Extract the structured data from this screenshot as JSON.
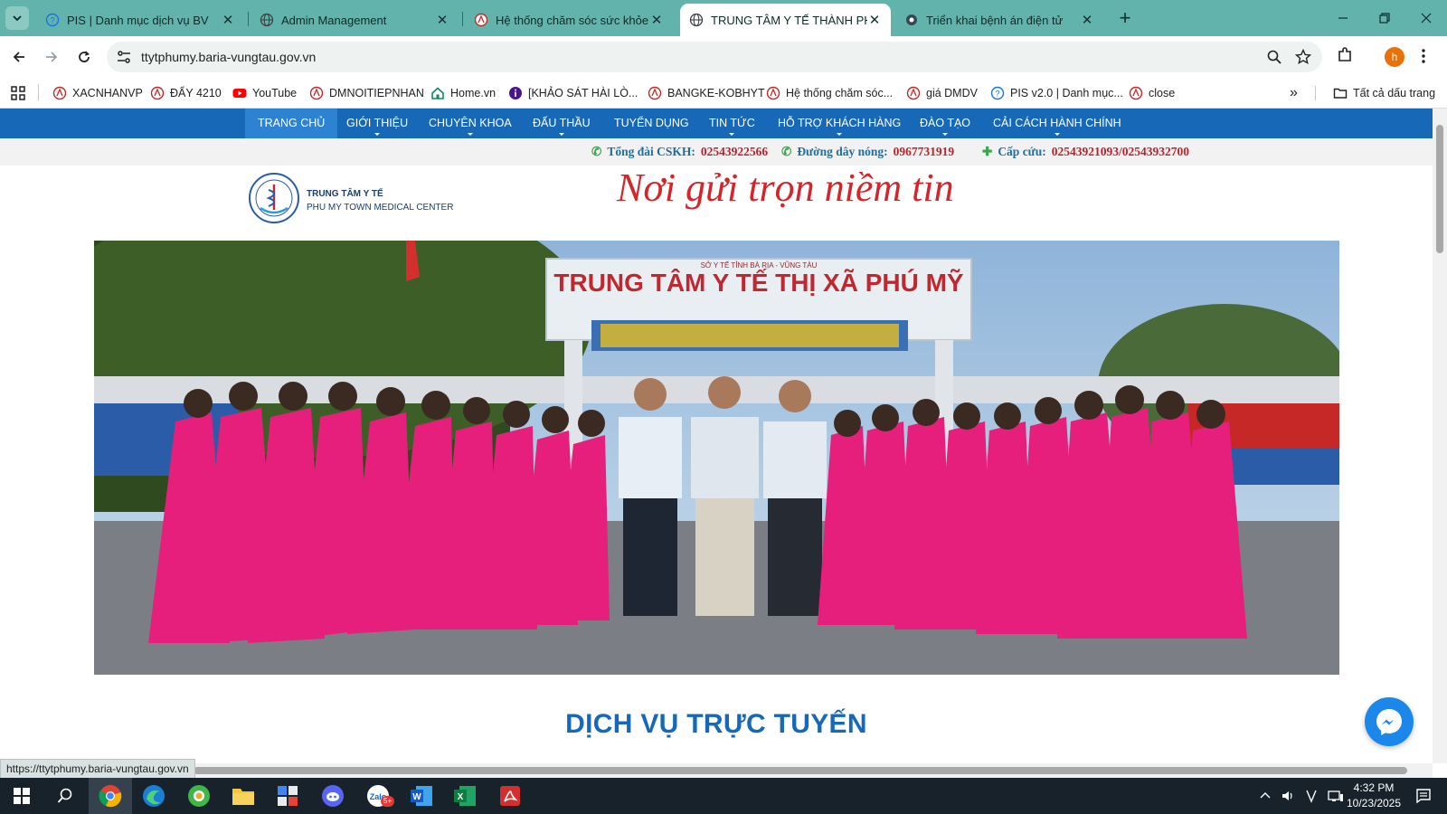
{
  "browser": {
    "tabs": [
      {
        "label": "PIS | Danh mục dịch vụ BV",
        "icon": "globe-question-icon",
        "active": false
      },
      {
        "label": "Admin Management",
        "icon": "globe-icon",
        "active": false
      },
      {
        "label": "Hệ thống chăm sóc sức khỏe",
        "icon": "health-logo-icon",
        "active": false
      },
      {
        "label": "TRUNG TÂM Y TẾ THÀNH PHỐ",
        "icon": "globe-icon",
        "active": true
      },
      {
        "label": "Triển khai bệnh án điện tử",
        "icon": "shield-gear-icon",
        "active": false
      }
    ],
    "url": "ttytphumy.baria-vungtau.gov.vn",
    "profile_initial": "h",
    "bookmarks": [
      {
        "label": "XACNHANVP",
        "icon": "health-logo-icon"
      },
      {
        "label": "ĐẨY 4210",
        "icon": "health-logo-icon"
      },
      {
        "label": "YouTube",
        "icon": "youtube-icon"
      },
      {
        "label": "DMNOITIEPNHAN",
        "icon": "health-logo-icon"
      },
      {
        "label": "Home.vn",
        "icon": "home-icon"
      },
      {
        "label": "[KHẢO SÁT HÀI LÒ...",
        "icon": "info-icon"
      },
      {
        "label": "BANGKE-KOBHYT",
        "icon": "health-logo-icon"
      },
      {
        "label": "Hệ thống chăm sóc...",
        "icon": "health-logo-icon"
      },
      {
        "label": "giá DMDV",
        "icon": "health-logo-icon"
      },
      {
        "label": "PIS v2.0 | Danh mục...",
        "icon": "globe-question-icon"
      },
      {
        "label": "close",
        "icon": "health-logo-icon"
      }
    ],
    "all_bookmarks_label": "Tất cả dấu trang",
    "status_url": "https://ttytphumy.baria-vungtau.gov.vn"
  },
  "site": {
    "nav": [
      {
        "label": "TRANG CHỦ",
        "caret": false,
        "active": true
      },
      {
        "label": "GIỚI THIỆU",
        "caret": true,
        "active": false
      },
      {
        "label": "CHUYÊN KHOA",
        "caret": true,
        "active": false
      },
      {
        "label": "ĐẤU THẦU",
        "caret": true,
        "active": false
      },
      {
        "label": "TUYỂN DỤNG",
        "caret": false,
        "active": false
      },
      {
        "label": "TIN TỨC",
        "caret": true,
        "active": false
      },
      {
        "label": "HỖ TRỢ KHÁCH HÀNG",
        "caret": true,
        "active": false
      },
      {
        "label": "ĐÀO TẠO",
        "caret": true,
        "active": false
      },
      {
        "label": "CẢI CÁCH HÀNH CHÍNH",
        "caret": true,
        "active": false
      }
    ],
    "hotlines": [
      {
        "label": "Tổng đài CSKH:",
        "value": "02543922566",
        "icon": "phone-icon"
      },
      {
        "label": "Đường dây nóng:",
        "value": "0967731919",
        "icon": "phone-icon"
      },
      {
        "label": "Cấp cứu:",
        "value": "02543921093/02543932700",
        "icon": "plus-icon"
      }
    ],
    "brand_line1": "TRUNG TÂM Y TẾ",
    "brand_line2": "PHU MY TOWN MEDICAL CENTER",
    "slogan": "Nơi gửi trọn niềm tin",
    "hero_sign": "TRUNG TÂM Y TẾ THỊ XÃ PHÚ MỸ",
    "hero_sign_top": "SỞ Y TẾ TỈNH BÀ RỊA - VŨNG TÀU",
    "section_title": "DỊCH VỤ TRỰC TUYẾN"
  },
  "taskbar": {
    "apps": [
      "chrome-icon",
      "edge-icon",
      "coccoc-icon",
      "file-explorer-icon",
      "app-icon",
      "discord-icon",
      "zalo-icon",
      "word-icon",
      "excel-icon",
      "acrobat-icon"
    ],
    "zalo_badge": "5+",
    "time": "4:32 PM",
    "date": "10/23/2025"
  },
  "colors": {
    "tab_strip": "#63b3ad",
    "nav_blue": "#1769b8",
    "hotline_red": "#c0202a",
    "slogan_red": "#d4252b"
  }
}
